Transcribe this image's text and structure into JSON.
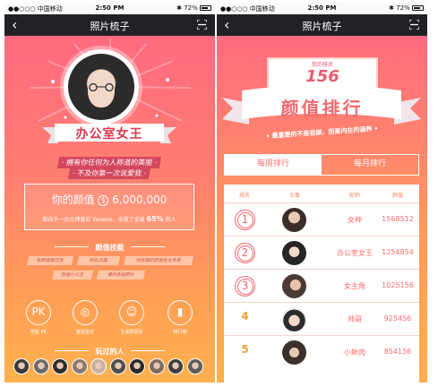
{
  "status_bar": {
    "carrier": "●●○○○ 中国移动",
    "time": "2:50 PM",
    "battery": "72%"
  },
  "left_screen": {
    "nav": {
      "title": "照片梳子"
    },
    "profile": {
      "name": "办公室女王",
      "slogan_line1": "· 拥有你任何为人称道的美丽 ·",
      "slogan_line2": "· 不及你第一次说爱我 ·"
    },
    "score": {
      "label": "你的颜值",
      "coin": "$",
      "value": "6,000,000",
      "rank_text": "和自于一台兰博基尼 Veneno，击败了全球",
      "rank_percent": "65%",
      "rank_suffix": "的人"
    },
    "skills_title": "颜值技能",
    "skills": [
      "有颜值就任性",
      "别处流露",
      "你在我的颜值有太多多",
      "颜值小公主",
      "请你多拍照片"
    ],
    "features": [
      {
        "label": "明星 PK",
        "icon": "pk-icon",
        "glyph": "PK"
      },
      {
        "label": "整容鉴定",
        "icon": "face-icon",
        "glyph": "◎"
      },
      {
        "label": "生成表情包",
        "icon": "emoji-icon",
        "glyph": "☺"
      },
      {
        "label": "排行榜",
        "icon": "chart-icon",
        "glyph": "▮"
      }
    ],
    "players_title": "玩过的人",
    "player_colors": [
      "#3b3b3b",
      "#6b6b6b",
      "#2f2f2f",
      "#8a7a6f",
      "#c9b0a0",
      "#4f4f4f",
      "#2a2a2a",
      "#7d6b5e",
      "#3f3f3f",
      "#5d5d5d"
    ]
  },
  "right_screen": {
    "nav": {
      "title": "照片梳子"
    },
    "my_rank_label": "我的排名",
    "my_rank": "156",
    "title": "颜值排行",
    "tagline": "• 最重要的不是容颜，而是内在的涵养 •",
    "tabs": {
      "weekly": "每周排行",
      "monthly": "每月排行"
    },
    "table_headers": {
      "rank": "排名",
      "avatar": "头像",
      "name": "昵称",
      "score": "颜值"
    },
    "rows": [
      {
        "rank": "1",
        "name": "女神",
        "score": "1568512"
      },
      {
        "rank": "2",
        "name": "办公室女王",
        "score": "1254854"
      },
      {
        "rank": "3",
        "name": "女主角",
        "score": "1025156"
      },
      {
        "rank": "4",
        "name": "帅哥",
        "score": "925456"
      },
      {
        "rank": "5",
        "name": "小鲜肉",
        "score": "854156"
      }
    ]
  }
}
